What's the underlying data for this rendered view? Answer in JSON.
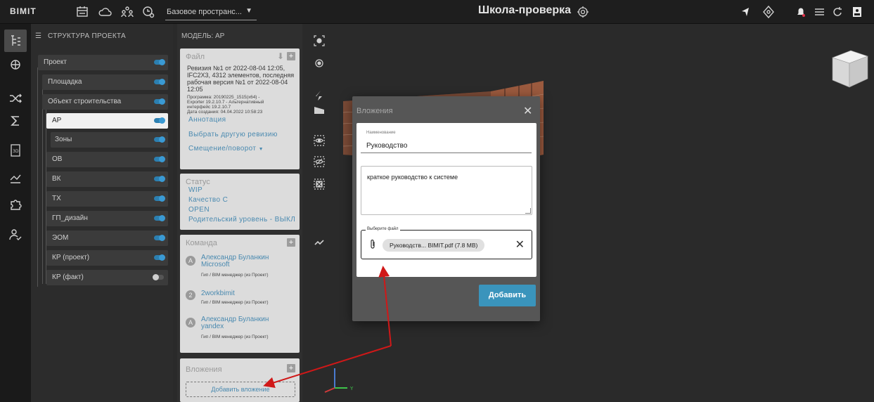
{
  "app": {
    "logo": "BIMIT",
    "space_select": "Базовое пространс...",
    "project_title": "Школа-проверка"
  },
  "structure": {
    "header": "СТРУКТУРА ПРОЕКТА",
    "items": [
      {
        "label": "Проект",
        "on": true
      },
      {
        "label": "Площадка",
        "on": true
      },
      {
        "label": "Объект строительства",
        "on": true
      },
      {
        "label": "АР",
        "on": true,
        "selected": true
      },
      {
        "label": "Зоны",
        "on": true
      },
      {
        "label": "ОВ",
        "on": true
      },
      {
        "label": "ВК",
        "on": true
      },
      {
        "label": "ТХ",
        "on": true
      },
      {
        "label": "ГП_дизайн",
        "on": true
      },
      {
        "label": "ЭОМ",
        "on": true
      },
      {
        "label": "КР (проект)",
        "on": true
      },
      {
        "label": "КР (факт)",
        "on": false
      }
    ]
  },
  "model": {
    "header": "МОДЕЛЬ: АР",
    "file": {
      "title": "Файл",
      "revision_lines": [
        "Ревизия №1 от 2022-08-04 12:05,",
        "IFC2X3, 4312 элементов, последняя",
        "рабочая версия №1 от 2022-08-04",
        "12:05"
      ],
      "program_lines": [
        "Программа: 20190225_1515(x64) -",
        "Exporter 19.2.10.7 - Альтернативный",
        "интерфейс 19.2.10.7",
        "Дата создания: 04.04.2022 10:58:23"
      ],
      "annotation": "Аннотация",
      "choose_revision": "Выбрать другую ревизию",
      "offset": "Смещение/поворот"
    },
    "status": {
      "title": "Статус",
      "lines": [
        "WIP",
        "Качество С",
        "OPEN",
        "Родительский уровень - ВЫКЛ"
      ]
    },
    "team": {
      "title": "Команда",
      "members": [
        {
          "initial": "А",
          "name": "Александр Буланкин Microsoft",
          "role": "Гип / BIM менеджер (из Проект)"
        },
        {
          "initial": "2",
          "name": "2workbimit",
          "role": "Гип / BIM менеджер (из Проект)"
        },
        {
          "initial": "А",
          "name": "Александр Буланкин yandex",
          "role": "Гип / BIM менеджер (из Проект)"
        }
      ]
    },
    "attachments": {
      "title": "Вложения",
      "add_label": "Добавить вложение"
    }
  },
  "modal": {
    "title": "Вложения",
    "name_label": "Наименование",
    "name_value": "Руководство",
    "description": "краткое руководство к системе",
    "file_label": "Выберите файл",
    "file_chip": "Руководств... BIMIT.pdf (7.8 MB)",
    "submit": "Добавить"
  },
  "axes": {
    "y_label": "Y"
  }
}
